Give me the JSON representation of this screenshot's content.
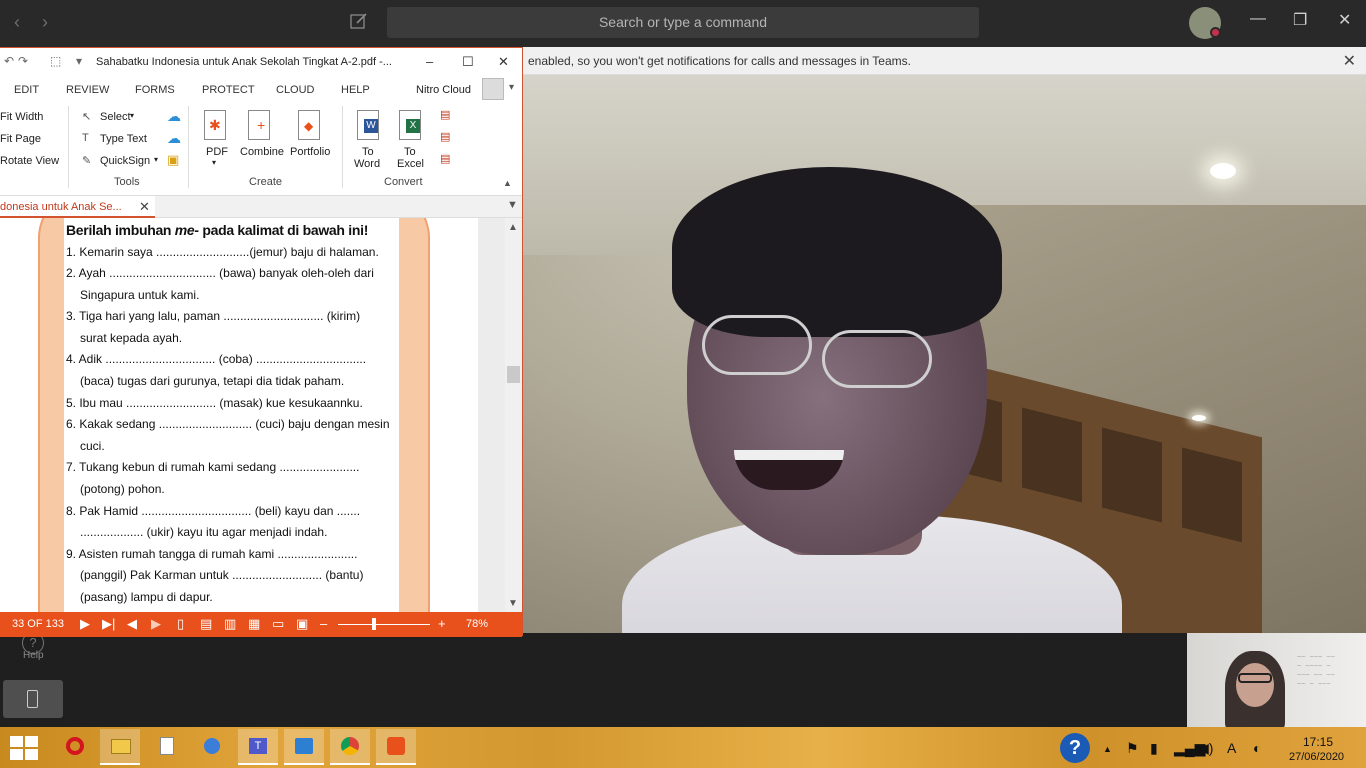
{
  "teams": {
    "search_placeholder": "Search or type a command",
    "banner_text": "enabled, so you won't get notifications for calls and messages in Teams.",
    "banner_close": "✕",
    "help_label": "Help",
    "help_icon": "?",
    "nav_back": "‹",
    "nav_forward": "›",
    "win_min": "—",
    "win_restore": "❐",
    "win_close": "✕"
  },
  "nitro": {
    "title": "Sahabatku Indonesia untuk Anak Sekolah Tingkat A-2.pdf -...",
    "win_min": "–",
    "win_max": "☐",
    "win_close": "✕",
    "tabs": [
      "EDIT",
      "REVIEW",
      "FORMS",
      "PROTECT",
      "CLOUD",
      "HELP"
    ],
    "cloud_user": "Nitro Cloud",
    "view_items": [
      "Fit Width",
      "Fit Page",
      "Rotate View"
    ],
    "tools_items": [
      "Select",
      "Type Text",
      "QuickSign"
    ],
    "groups": {
      "tools": "Tools",
      "create": "Create",
      "convert": "Convert"
    },
    "create_buttons": [
      "PDF",
      "Combine",
      "Portfolio"
    ],
    "convert_buttons": [
      [
        "To",
        "Word"
      ],
      [
        "To",
        "Excel"
      ]
    ],
    "doc_tab": "donesia untuk Anak Se...",
    "doc_tab_close": "✕",
    "status": {
      "page": "33 OF 133",
      "zoom": "78%"
    }
  },
  "document": {
    "heading_pre": "Berilah imbuhan ",
    "heading_em": "me-",
    "heading_post": " pada kalimat di bawah ini!",
    "lines": [
      {
        "n": "1. Kemarin saya  ............................(jemur) baju di halaman."
      },
      {
        "n": "2. Ayah ................................ (bawa)  banyak  oleh-oleh  dari"
      },
      {
        "c": "Singapura untuk kami."
      },
      {
        "n": "3. Tiga  hari yang lalu, paman .............................. (kirim)"
      },
      {
        "c": "surat kepada ayah."
      },
      {
        "n": "4. Adik ................................. (coba) ................................."
      },
      {
        "c": "(baca) tugas dari gurunya, tetapi dia  tidak paham."
      },
      {
        "n": "5. Ibu mau ........................... (masak) kue kesukaannku."
      },
      {
        "n": "6. Kakak sedang ............................ (cuci) baju dengan mesin"
      },
      {
        "c": "cuci."
      },
      {
        "n": "7. Tukang kebun di rumah kami sedang ........................"
      },
      {
        "c": "(potong) pohon."
      },
      {
        "n": "8. Pak Hamid ................................. (beli) kayu dan ......."
      },
      {
        "c": "................... (ukir) kayu itu agar menjadi indah."
      },
      {
        "n": "9. Asisten rumah tangga di rumah kami ........................"
      },
      {
        "c": "(panggil) Pak Karman untuk ........................... (bantu)"
      },
      {
        "c": "(pasang) lampu di dapur."
      }
    ]
  },
  "taskbar": {
    "time": "17:15",
    "date": "27/06/2020",
    "tray_lang": "A",
    "tray_help": "?",
    "tray_caret": "▲"
  },
  "colors": {
    "nitro_accent": "#e8501c",
    "teams_dark": "#292929",
    "taskbar": "#e1a43a"
  }
}
